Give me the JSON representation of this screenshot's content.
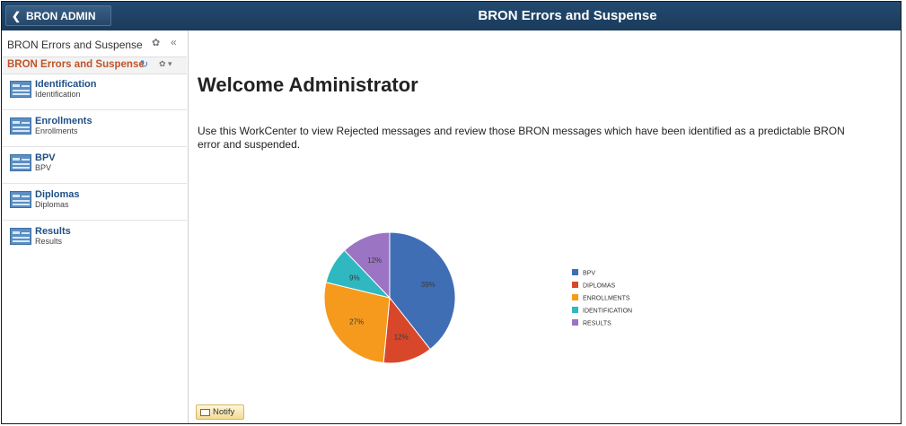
{
  "banner": {
    "back_label": "BRON ADMIN",
    "title": "BRON Errors and Suspense"
  },
  "sidebar": {
    "header": "BRON Errors and Suspense",
    "section_title": "BRON Errors and Suspense",
    "items": [
      {
        "title": "Identification",
        "subtitle": "Identification"
      },
      {
        "title": "Enrollments",
        "subtitle": "Enrollments"
      },
      {
        "title": "BPV",
        "subtitle": "BPV"
      },
      {
        "title": "Diplomas",
        "subtitle": "Diplomas"
      },
      {
        "title": "Results",
        "subtitle": "Results"
      }
    ]
  },
  "main": {
    "welcome": "Welcome Administrator",
    "description": "Use this WorkCenter to view Rejected messages and review those BRON messages which have been identified as a predictable BRON error and suspended.",
    "notify_label": "Notify"
  },
  "chart_data": {
    "type": "pie",
    "slices": [
      {
        "label": "BPV",
        "value": 39,
        "display": "39%",
        "color": "#3f6eb5"
      },
      {
        "label": "DIPLOMAS",
        "value": 12,
        "display": "12%",
        "color": "#d9472b"
      },
      {
        "label": "ENROLLMENTS",
        "value": 27,
        "display": "27%",
        "color": "#f59a1c"
      },
      {
        "label": "IDENTIFICATION",
        "value": 9,
        "display": "9%",
        "color": "#2fb8c0"
      },
      {
        "label": "RESULTS",
        "value": 12,
        "display": "12%",
        "color": "#9b74c4"
      }
    ],
    "legend_position": "right"
  }
}
